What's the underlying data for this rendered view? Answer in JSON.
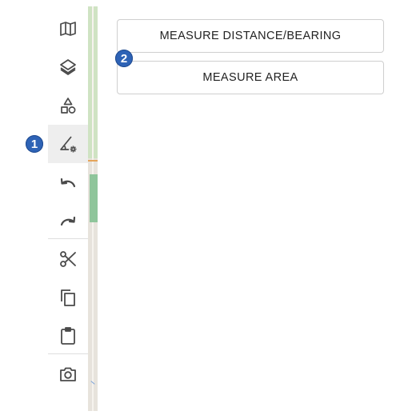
{
  "toolbar": {
    "tools": [
      {
        "icon": "map-icon"
      },
      {
        "icon": "layers-icon"
      },
      {
        "icon": "shapes-icon"
      },
      {
        "icon": "measure-tool-icon",
        "active": true
      },
      {
        "icon": "undo-icon"
      },
      {
        "icon": "redo-icon"
      },
      {
        "icon": "scissors-icon"
      },
      {
        "icon": "copy-icon"
      },
      {
        "icon": "clipboard-icon"
      },
      {
        "icon": "camera-icon"
      }
    ]
  },
  "measure_panel": {
    "distance_label": "MEASURE DISTANCE/BEARING",
    "area_label": "MEASURE AREA"
  },
  "markers": {
    "one": "1",
    "two": "2"
  },
  "colors": {
    "marker": "#2e63b6",
    "icon": "#4a4a4a",
    "active_tool_bg": "#eeeeee"
  }
}
